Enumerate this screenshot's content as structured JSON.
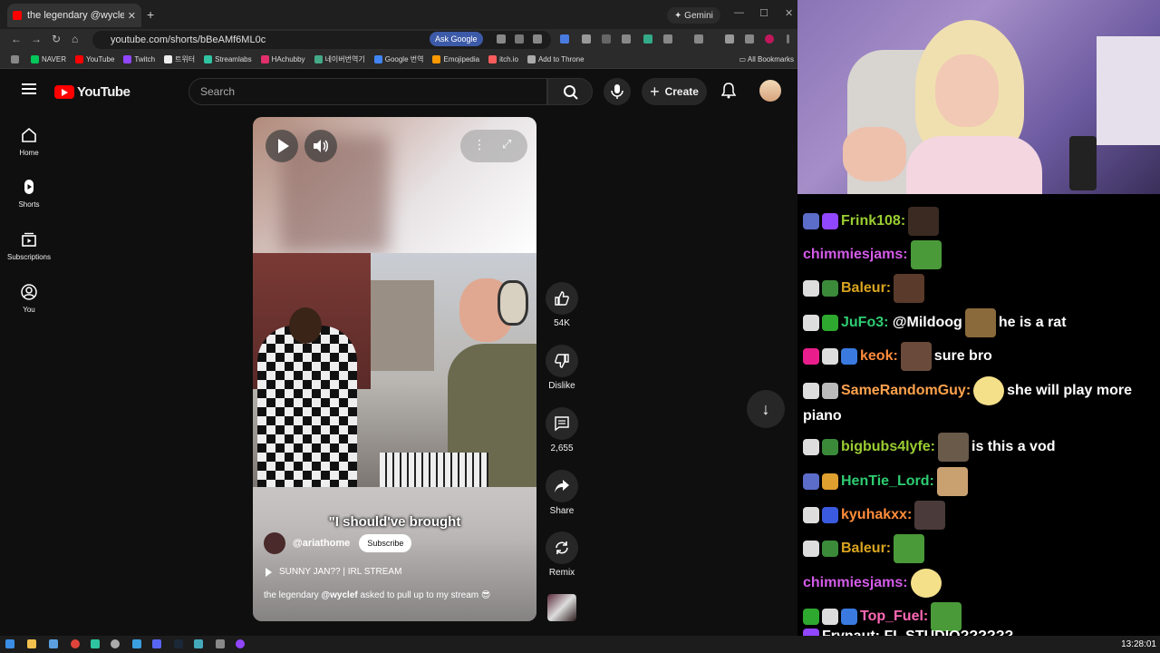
{
  "browser": {
    "tab_title": "the legendary @wyclef asked t",
    "gemini_label": "Gemini",
    "url": "youtube.com/shorts/bBeAMf6ML0c",
    "ask_google_label": "Ask Google",
    "bookmarks": [
      "NAVER",
      "YouTube",
      "Twitch",
      "트위터",
      "Streamlabs",
      "HAchubby",
      "네이버번역기",
      "Google 번역",
      "Emojipedia",
      "itch.io",
      "Add to Throne"
    ],
    "all_bookmarks_label": "All Bookmarks"
  },
  "youtube": {
    "logo_text": "YouTube",
    "search_placeholder": "Search",
    "create_label": "Create",
    "nav": [
      {
        "label": "Home",
        "icon": "home-icon"
      },
      {
        "label": "Shorts",
        "icon": "shorts-icon"
      },
      {
        "label": "Subscriptions",
        "icon": "subscriptions-icon"
      },
      {
        "label": "You",
        "icon": "you-icon"
      }
    ],
    "short": {
      "caption": "\"I should've brought",
      "channel": "@ariathome",
      "subscribe_label": "Subscribe",
      "stream_title": "SUNNY JAN?? | IRL STREAM",
      "description_prefix": "the legendary ",
      "description_mention": "@wyclef",
      "description_suffix": " asked to pull up to my stream 😎"
    },
    "actions": {
      "like_count": "54K",
      "dislike_label": "Dislike",
      "comments_count": "2,655",
      "share_label": "Share",
      "remix_label": "Remix"
    }
  },
  "chat": {
    "messages": [
      {
        "user": "Frink108:",
        "color": "#9acd32",
        "text": ""
      },
      {
        "user": "chimmiesjams:",
        "color": "#d35be8",
        "text": ""
      },
      {
        "user": "Baleur:",
        "color": "#daa520",
        "text": ""
      },
      {
        "user": "JuFo3:",
        "color": "#2ecc71",
        "text": "@Mildoog",
        "text2": "he is a rat"
      },
      {
        "user": "keok:",
        "color": "#ff8c3a",
        "text": "sure bro"
      },
      {
        "user": "SameRandomGuy:",
        "color": "#ffa34d",
        "text": "she will play more",
        "text_wrap": "piano"
      },
      {
        "user": "bigbubs4lyfe:",
        "color": "#9acd32",
        "text": "is this a vod"
      },
      {
        "user": "HenTie_Lord:",
        "color": "#2ecc71",
        "text": ""
      },
      {
        "user": "kyuhakxx:",
        "color": "#ff8c3a",
        "text": ""
      },
      {
        "user": "Baleur:",
        "color": "#daa520",
        "text": ""
      },
      {
        "user": "chimmiesjams:",
        "color": "#d35be8",
        "text": ""
      },
      {
        "user": "Top_Fuel:",
        "color": "#ff69b4",
        "text": ""
      },
      {
        "user": "Frynaut:",
        "color": "#ffffff",
        "text": "FL STUDIO??????"
      }
    ]
  },
  "taskbar": {
    "clock": "13:28:01"
  }
}
